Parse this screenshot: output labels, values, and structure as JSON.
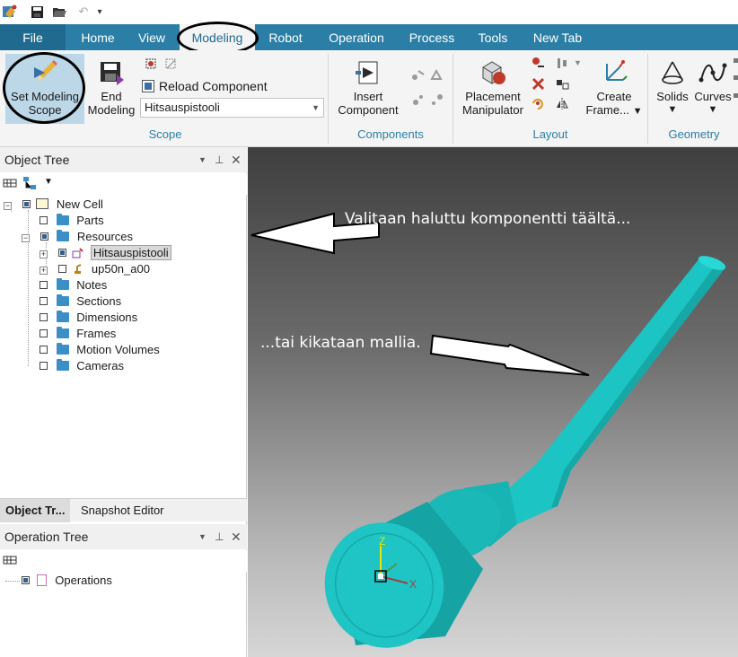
{
  "quick_access": {
    "icons": [
      "app-logo-icon",
      "save-icon",
      "open-icon",
      "undo-icon",
      "customize-icon"
    ]
  },
  "tabs": [
    {
      "label": "File"
    },
    {
      "label": "Home"
    },
    {
      "label": "View"
    },
    {
      "label": "Modeling"
    },
    {
      "label": "Robot"
    },
    {
      "label": "Operation"
    },
    {
      "label": "Process"
    },
    {
      "label": "Tools"
    },
    {
      "label": "New Tab"
    }
  ],
  "ribbon": {
    "scope": {
      "set_modeling_scope": "Set Modeling Scope",
      "set_modeling_scope_line1": "Set Modeling",
      "set_modeling_scope_line2": "Scope",
      "end_modeling_line1": "End",
      "end_modeling_line2": "Modeling",
      "reload_component": "Reload Component",
      "component_select": "Hitsauspistooli",
      "label": "Scope"
    },
    "components": {
      "insert_line1": "Insert",
      "insert_line2": "Component",
      "label": "Components"
    },
    "layout": {
      "placement_line1": "Placement",
      "placement_line2": "Manipulator",
      "create_frame_line1": "Create",
      "create_frame_line2": "Frame...",
      "label": "Layout"
    },
    "geometry": {
      "solids": "Solids",
      "curves": "Curves",
      "label": "Geometry"
    }
  },
  "object_tree": {
    "title": "Object Tree",
    "items": [
      {
        "label": "New Cell"
      },
      {
        "label": "Parts"
      },
      {
        "label": "Resources"
      },
      {
        "label": "Hitsauspistooli"
      },
      {
        "label": "up50n_a00"
      },
      {
        "label": "Notes"
      },
      {
        "label": "Sections"
      },
      {
        "label": "Dimensions"
      },
      {
        "label": "Frames"
      },
      {
        "label": "Motion Volumes"
      },
      {
        "label": "Cameras"
      }
    ]
  },
  "bottom_tabs": [
    {
      "label": "Object Tr..."
    },
    {
      "label": "Snapshot Editor"
    }
  ],
  "operation_tree": {
    "title": "Operation Tree",
    "items": [
      {
        "label": "Operations"
      }
    ]
  },
  "viewport": {
    "callout_1": "Valitaan haluttu komponentti täältä...",
    "callout_2": "...tai kikataan mallia.",
    "axis_z": "Z",
    "axis_x": "X",
    "model_color": "#1fc4c4"
  }
}
